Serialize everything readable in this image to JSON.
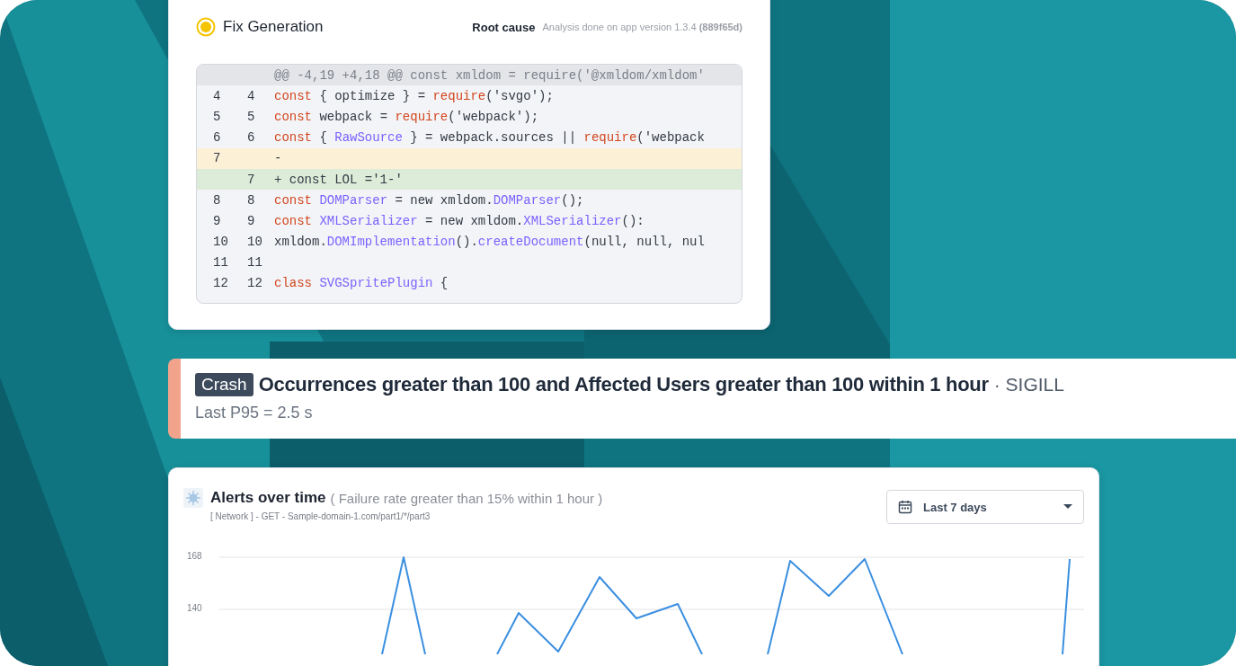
{
  "fix_card": {
    "title": "Fix Generation",
    "root_cause_label": "Root cause",
    "analysis_note": "Analysis done on app version 1.3.4 **(889f65d)**",
    "diff": [
      {
        "kind": "header",
        "tokens": [
          {
            "t": "@@ -4,19 +4,18 @@ const xmldom = require('@xmldom/xmldom'",
            "kind": "meta"
          }
        ]
      },
      {
        "kind": "context",
        "old": "4",
        "new": "4",
        "tokens": [
          {
            "t": "const",
            "kind": "keyword"
          },
          {
            "t": " { optimize } = ",
            "kind": "plain"
          },
          {
            "t": "require",
            "kind": "keyword"
          },
          {
            "t": "('svgo');",
            "kind": "plain"
          }
        ]
      },
      {
        "kind": "context",
        "old": "5",
        "new": "5",
        "tokens": [
          {
            "t": "const",
            "kind": "keyword"
          },
          {
            "t": " webpack = ",
            "kind": "plain"
          },
          {
            "t": "require",
            "kind": "keyword"
          },
          {
            "t": "('webpack');",
            "kind": "plain"
          }
        ]
      },
      {
        "kind": "context",
        "old": "6",
        "new": "6",
        "tokens": [
          {
            "t": "const",
            "kind": "keyword"
          },
          {
            "t": " { ",
            "kind": "plain"
          },
          {
            "t": "RawSource",
            "kind": "name"
          },
          {
            "t": " } = webpack.sources || ",
            "kind": "plain"
          },
          {
            "t": "require",
            "kind": "keyword"
          },
          {
            "t": "('webpack",
            "kind": "plain"
          }
        ]
      },
      {
        "kind": "removed",
        "old": "7",
        "tokens": [
          {
            "t": "-",
            "kind": "plain"
          }
        ]
      },
      {
        "kind": "added",
        "new": "7",
        "tokens": [
          {
            "t": "+ const LOL ='1-'",
            "kind": "plain"
          }
        ]
      },
      {
        "kind": "context",
        "old": "8",
        "new": "8",
        "tokens": [
          {
            "t": "const",
            "kind": "keyword"
          },
          {
            "t": " DOMParser",
            "kind": "name"
          },
          {
            "t": " = new xmldom.",
            "kind": "plain"
          },
          {
            "t": "DOMParser",
            "kind": "name"
          },
          {
            "t": "();",
            "kind": "plain"
          }
        ]
      },
      {
        "kind": "context",
        "old": "9",
        "new": "9",
        "tokens": [
          {
            "t": "const",
            "kind": "keyword"
          },
          {
            "t": " XMLSerializer",
            "kind": "name"
          },
          {
            "t": " = new xmldom.",
            "kind": "plain"
          },
          {
            "t": "XMLSerializer",
            "kind": "name"
          },
          {
            "t": "():",
            "kind": "plain"
          }
        ]
      },
      {
        "kind": "context",
        "old": "10",
        "new": "10",
        "tokens": [
          {
            "t": "xmldom.",
            "kind": "plain"
          },
          {
            "t": "DOMImplementation",
            "kind": "name"
          },
          {
            "t": "().",
            "kind": "plain"
          },
          {
            "t": "createDocument",
            "kind": "name"
          },
          {
            "t": "(null, null, nul",
            "kind": "plain"
          }
        ]
      },
      {
        "kind": "context",
        "old": "11",
        "new": "11"
      },
      {
        "kind": "context",
        "old": "12",
        "new": "12",
        "tokens": [
          {
            "t": "class",
            "kind": "keyword"
          },
          {
            "t": " SVGSpritePlugin",
            "kind": "name"
          },
          {
            "t": " {",
            "kind": "plain"
          }
        ]
      }
    ]
  },
  "alert_banner": {
    "color": "#f2a38c",
    "badge": "Crash",
    "title": "Occurrences greater than 100 and Affected Users greater than 100 within 1 hour",
    "suffix": "· SIGILL",
    "subtitle": "Last P95 = 2.5 s"
  },
  "alerts_card": {
    "title": "Alerts over time",
    "condition": "( Failure rate greater than 15% within 1 hour )",
    "subtitle": "[ Network ] - GET - Sample-domain-1.com/part1/*/part3",
    "range_dropdown": {
      "value": "Last 7 days"
    },
    "y_axis_labels": [
      "168",
      "140"
    ]
  }
}
